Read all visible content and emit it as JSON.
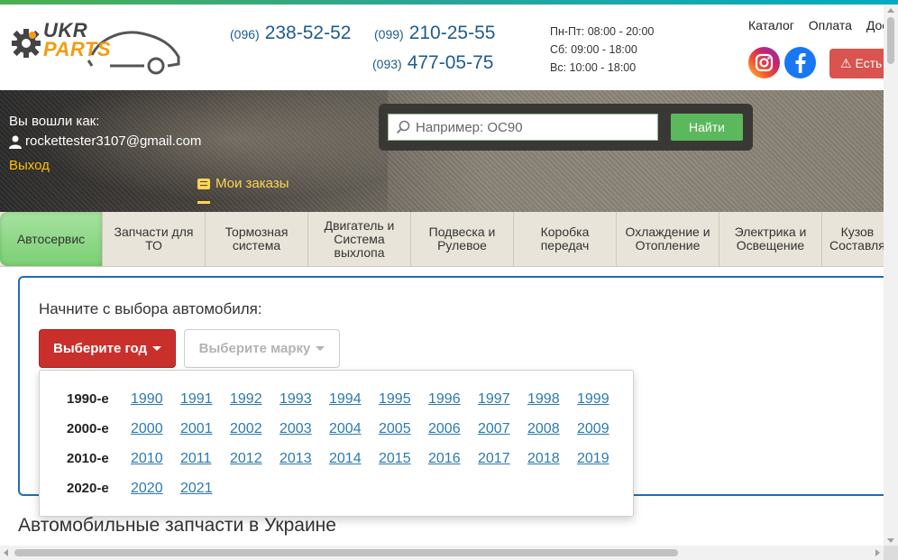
{
  "header": {
    "logo": {
      "line1": "UKR",
      "line2": "PARTS"
    },
    "phones": [
      {
        "code": "(096)",
        "number": "238-52-52"
      },
      {
        "code": "(099)",
        "number": "210-25-55"
      },
      {
        "code": "(093)",
        "number": "477-05-75"
      }
    ],
    "hours": [
      "Пн-Пт: 08:00 - 20:00",
      "Сб: 09:00 - 18:00",
      "Вс: 10:00 - 18:00"
    ],
    "nav": [
      "Каталог",
      "Оплата",
      "Дос"
    ],
    "social": [
      "instagram-icon",
      "facebook-icon"
    ],
    "error_button": "Есть"
  },
  "user": {
    "logged_as": "Вы вошли как:",
    "email": "rockettester3107@gmail.com",
    "logout": "Выход",
    "orders": "Мои заказы"
  },
  "search": {
    "placeholder": "Например: OC90",
    "button": "Найти"
  },
  "categories": [
    "Автосервис",
    "Запчасти для ТО",
    "Тормозная система",
    "Двигатель и Система выхлопа",
    "Подвеска и Рулевое",
    "Коробка передач",
    "Охлаждение и Отопление",
    "Электрика и Освещение",
    "Кузов Составля"
  ],
  "selector": {
    "title": "Начните с выбора автомобиля:",
    "year_button": "Выберите год",
    "brand_button": "Выберите марку"
  },
  "year_dropdown": [
    {
      "decade": "1990-е",
      "years": [
        "1990",
        "1991",
        "1992",
        "1993",
        "1994",
        "1995",
        "1996",
        "1997",
        "1998",
        "1999"
      ]
    },
    {
      "decade": "2000-е",
      "years": [
        "2000",
        "2001",
        "2002",
        "2003",
        "2004",
        "2005",
        "2006",
        "2007",
        "2008",
        "2009"
      ]
    },
    {
      "decade": "2010-е",
      "years": [
        "2010",
        "2011",
        "2012",
        "2013",
        "2014",
        "2015",
        "2016",
        "2017",
        "2018",
        "2019"
      ]
    },
    {
      "decade": "2020-е",
      "years": [
        "2020",
        "2021"
      ]
    }
  ],
  "bottom_title": "Автомобильные запчасти в Украине",
  "colors": {
    "accent_green": "#5cb85c",
    "year_button_red": "#c9302c",
    "link_blue": "#2a7ab0",
    "panel_border": "#1f6db3",
    "phone_blue": "#1f5b8f"
  }
}
